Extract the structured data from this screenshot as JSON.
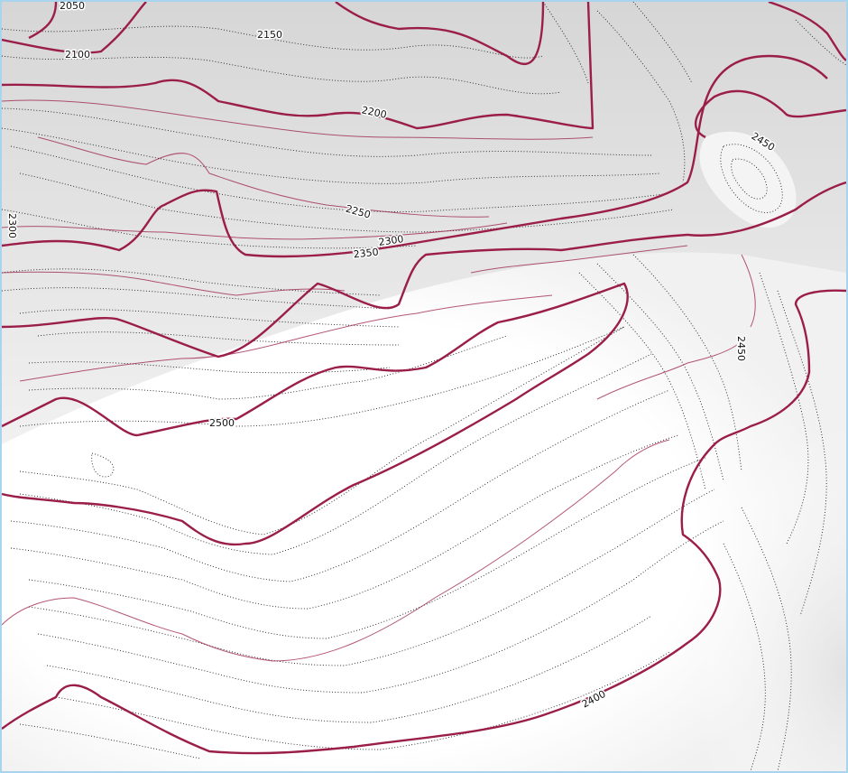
{
  "map": {
    "type": "topographic-contour",
    "colors": {
      "index_contour": "#9b1e4a",
      "minor_contour": "#222222",
      "shade_dark": "#d9d9d9",
      "shade_light": "#ffffff",
      "border": "#a9d4ee"
    },
    "contour_labels": {
      "l2050": "2050",
      "l2100": "2100",
      "l2150": "2150",
      "l2200": "2200",
      "l2250": "2250",
      "l2300a": "2300",
      "l2300b": "2300",
      "l2350": "2350",
      "l2450a": "2450",
      "l2450b": "2450",
      "l2500": "2500",
      "l2400": "2400"
    }
  }
}
